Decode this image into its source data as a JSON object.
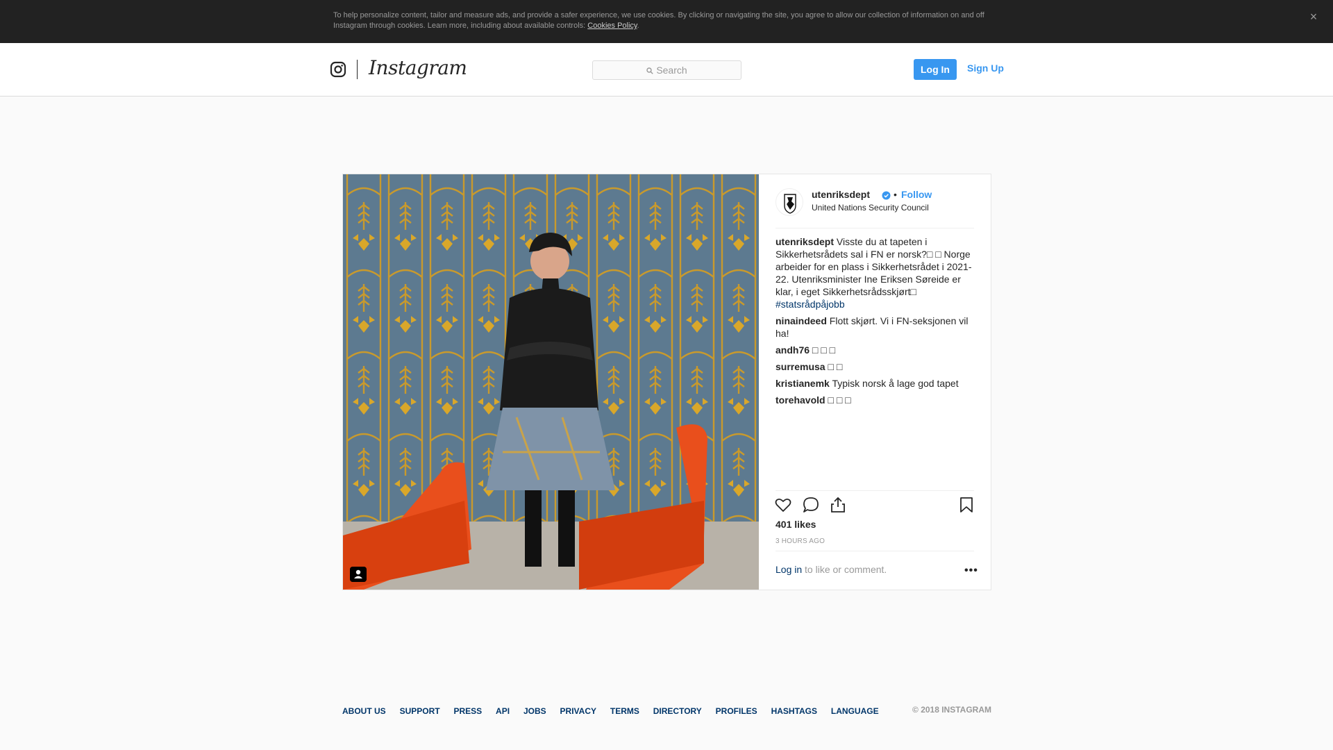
{
  "cookie_banner": {
    "text": "To help personalize content, tailor and measure ads, and provide a safer experience, we use cookies. By clicking or navigating the site, you agree to allow our collection of information on and off Instagram through cookies. Learn more, including about available controls: ",
    "link": "Cookies Policy",
    "period": ".",
    "close_glyph": "×"
  },
  "header": {
    "wordmark": "Instagram",
    "search_placeholder": "Search",
    "login_label": "Log In",
    "signup_label": "Sign Up",
    "accent": "#3897f0"
  },
  "post": {
    "username": "utenriksdept",
    "verified": true,
    "dot": "•",
    "follow_label": "Follow",
    "location": "United Nations Security Council",
    "caption": {
      "user": "utenriksdept",
      "text": "Visste du at tapeten i Sikkerhetsrådets sal i FN er norsk?□ □  Norge arbeider for en plass i Sikkerhetsrådet i 2021-22. Utenriksminister Ine Eriksen Søreide er klar, i eget Sikkerhetsrådsskjørt□",
      "hashtag": "#statsrådpåjobb"
    },
    "comments": [
      {
        "user": "ninaindeed",
        "text": "Flott skjørt. Vi i FN-seksjonen vil ha!"
      },
      {
        "user": "andh76",
        "text": "□ □ □"
      },
      {
        "user": "surremusa",
        "text": "□ □"
      },
      {
        "user": "kristianemk",
        "text": "Typisk norsk å lage god tapet"
      },
      {
        "user": "torehavold",
        "text": "□ □ □"
      }
    ],
    "likes": "401 likes",
    "timestamp": "3 HOURS AGO",
    "login_link": "Log in",
    "login_rest": " to like or comment.",
    "more_glyph": "•••",
    "icons": [
      "heart-icon",
      "comment-icon",
      "share-icon",
      "bookmark-icon",
      "tagged-user-icon"
    ]
  },
  "footer": {
    "links": [
      "ABOUT US",
      "SUPPORT",
      "PRESS",
      "API",
      "JOBS",
      "PRIVACY",
      "TERMS",
      "DIRECTORY",
      "PROFILES",
      "HASHTAGS",
      "LANGUAGE"
    ],
    "copyright": "© 2018 INSTAGRAM"
  }
}
